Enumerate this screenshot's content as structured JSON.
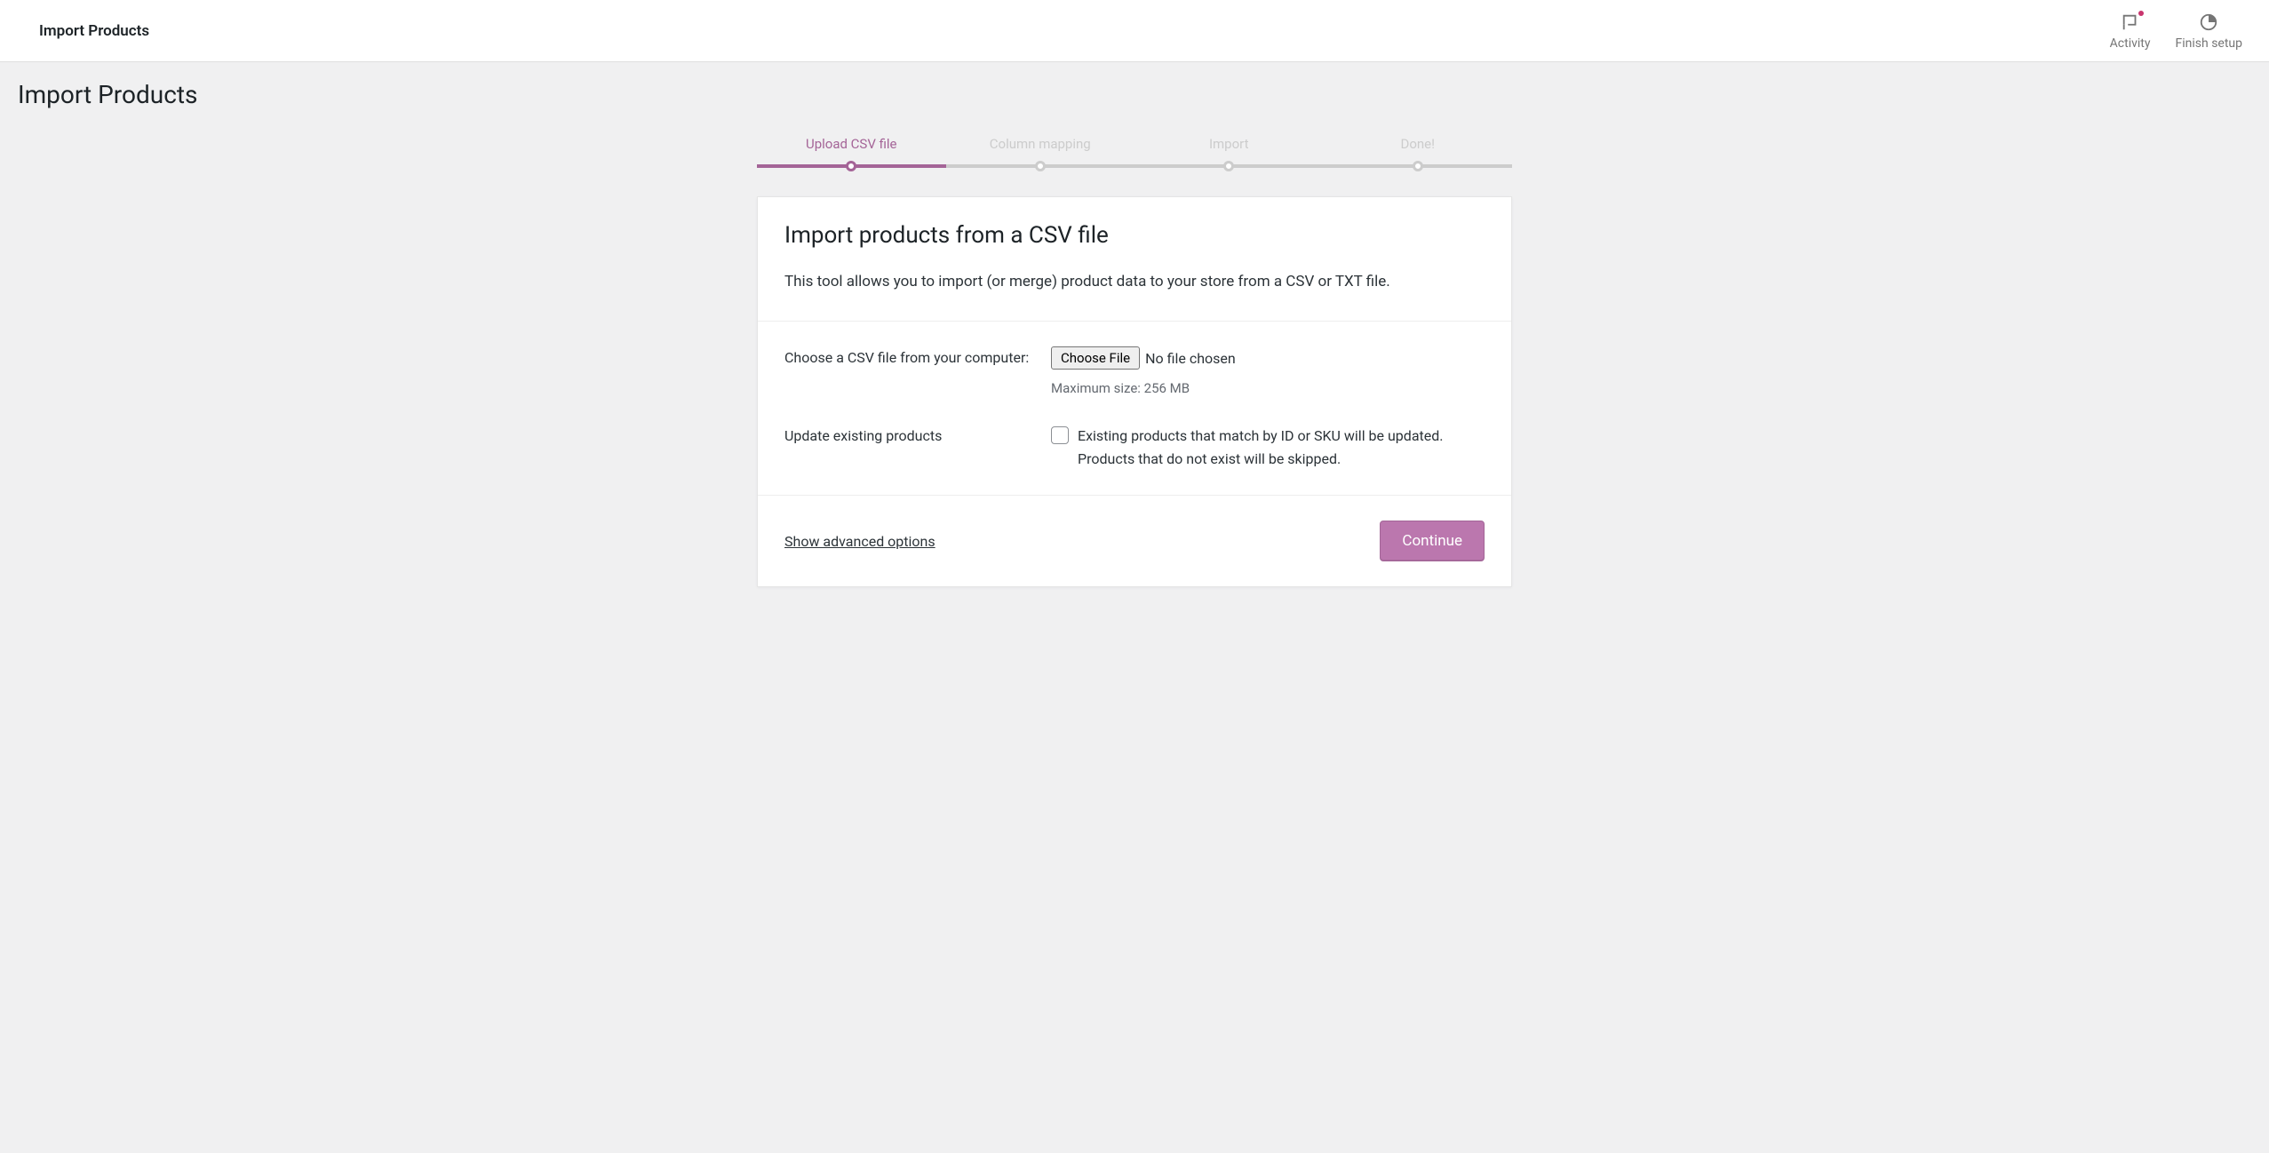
{
  "header": {
    "title": "Import Products",
    "activity_label": "Activity",
    "finish_setup_label": "Finish setup"
  },
  "page": {
    "heading": "Import Products"
  },
  "steps": [
    {
      "label": "Upload CSV file",
      "active": true
    },
    {
      "label": "Column mapping",
      "active": false
    },
    {
      "label": "Import",
      "active": false
    },
    {
      "label": "Done!",
      "active": false
    }
  ],
  "card": {
    "title": "Import products from a CSV file",
    "description": "This tool allows you to import (or merge) product data to your store from a CSV or TXT file.",
    "file_label": "Choose a CSV file from your computer:",
    "choose_file_button": "Choose File",
    "no_file_chosen": "No file chosen",
    "max_size": "Maximum size: 256 MB",
    "update_label": "Update existing products",
    "update_description": "Existing products that match by ID or SKU will be updated. Products that do not exist will be skipped.",
    "advanced_link": "Show advanced options",
    "continue_button": "Continue"
  }
}
